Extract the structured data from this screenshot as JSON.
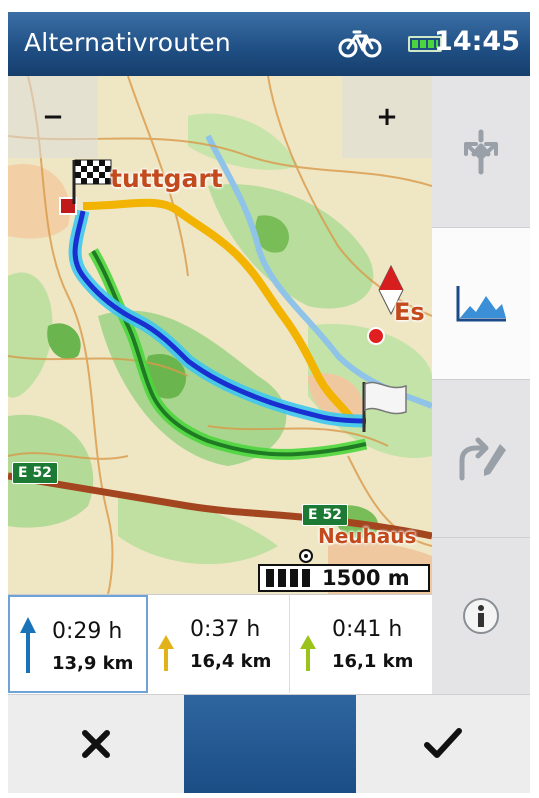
{
  "header": {
    "title": "Alternativrouten",
    "time": "14:45",
    "icons": [
      "bike-icon",
      "battery-icon"
    ]
  },
  "map": {
    "labels": {
      "stuttgart": "tuttgart",
      "es": "Es",
      "neuhaus": "Neuhaus",
      "e52_left": "E 52",
      "e52_right": "E 52"
    },
    "zoom_out_label": "−",
    "zoom_in_label": "+",
    "scale_label": "1500 m"
  },
  "side_panel": {
    "buttons": [
      {
        "name": "route-options",
        "icon": "route-arrows-icon"
      },
      {
        "name": "elevation-profile",
        "icon": "elevation-icon",
        "active": true
      },
      {
        "name": "edit-route",
        "icon": "edit-route-icon"
      },
      {
        "name": "info",
        "icon": "info-icon"
      }
    ]
  },
  "routes": [
    {
      "time": "0:29 h",
      "distance": "13,9 km",
      "color": "#1a73b8",
      "selected": true
    },
    {
      "time": "0:37 h",
      "distance": "16,4 km",
      "color": "#e2b21a",
      "selected": false
    },
    {
      "time": "0:41 h",
      "distance": "16,1 km",
      "color": "#9cc31c",
      "selected": false
    }
  ],
  "footer": {
    "cancel_icon": "close-icon",
    "confirm_icon": "checkmark-icon"
  },
  "colors": {
    "title_bar": "#1f4e83",
    "route_blue": "#1a3fcf",
    "route_yellow": "#f2b400",
    "route_green": "#1f8a2a"
  }
}
